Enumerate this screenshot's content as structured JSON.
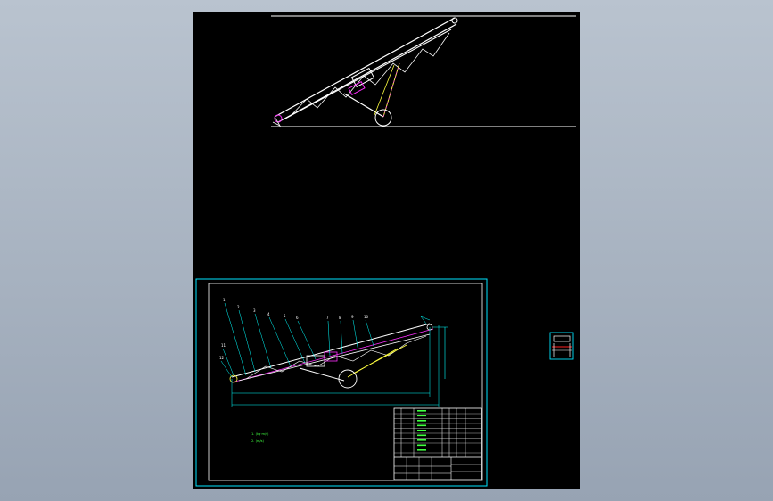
{
  "canvas": {
    "background": "#000000",
    "outer_background": "#aab4c2"
  },
  "colors": {
    "frame": "#00e5ff",
    "truss": "#ffffff",
    "magenta": "#ff30ff",
    "yellow": "#ffff40",
    "green": "#40ff40",
    "cyan": "#00ffff",
    "red": "#ff2020",
    "table": "#ffffff"
  },
  "drawing": {
    "notes": [
      "1.  (kg·m/s)",
      "2.  (m/s)"
    ],
    "balloons": [
      "1",
      "2",
      "3",
      "4",
      "5",
      "6",
      "7",
      "8",
      "9",
      "10",
      "11",
      "12"
    ],
    "title_block": {
      "drawing_no": ""
    }
  }
}
